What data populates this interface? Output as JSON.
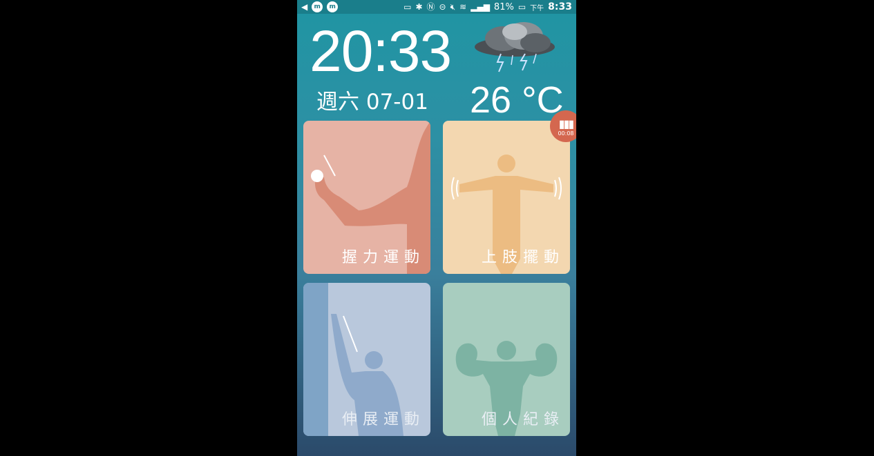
{
  "status_bar": {
    "battery": "81%",
    "time_prefix": "下午",
    "time": "8:33"
  },
  "home": {
    "clock": "20:33",
    "date": "週六 07-01",
    "temperature": "26 °C",
    "weather_icon": "thunderstorm-cloud-icon"
  },
  "recording": {
    "elapsed": "00:08"
  },
  "tiles": [
    {
      "label": "握力運動",
      "color": "#e6b3a5"
    },
    {
      "label": "上肢擺動",
      "color": "#f3d7b0"
    },
    {
      "label": "伸展運動",
      "color": "#b9c8dc"
    },
    {
      "label": "個人紀錄",
      "color": "#a8cdbf"
    }
  ]
}
